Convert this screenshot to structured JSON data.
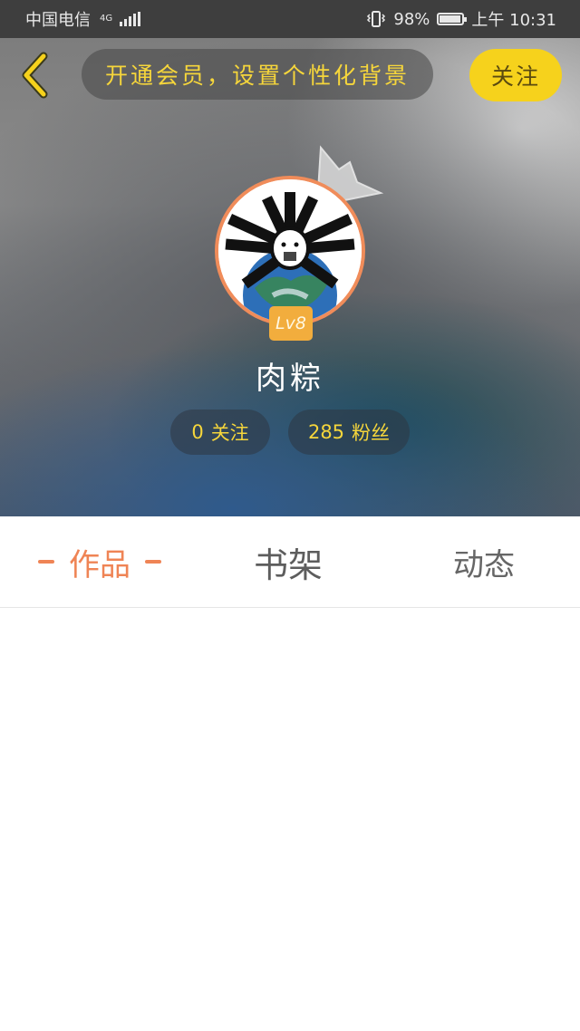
{
  "status_bar": {
    "carrier": "中国电信",
    "network": "4G",
    "battery_percent": "98%",
    "time": "上午 10:31"
  },
  "header": {
    "banner_text": "开通会员，设置个性化背景",
    "follow_label": "关注"
  },
  "profile": {
    "level": "Lv8",
    "username": "肉粽",
    "following_count": "0",
    "following_label": "关注",
    "fans_count": "285",
    "fans_label": "粉丝"
  },
  "tabs": [
    {
      "label": "作品",
      "active": true
    },
    {
      "label": "书架",
      "active": false
    },
    {
      "label": "动态",
      "active": false
    }
  ],
  "colors": {
    "accent_yellow": "#f6d21c",
    "active_tab": "#ef8455",
    "level_badge": "#f2ad3d"
  }
}
